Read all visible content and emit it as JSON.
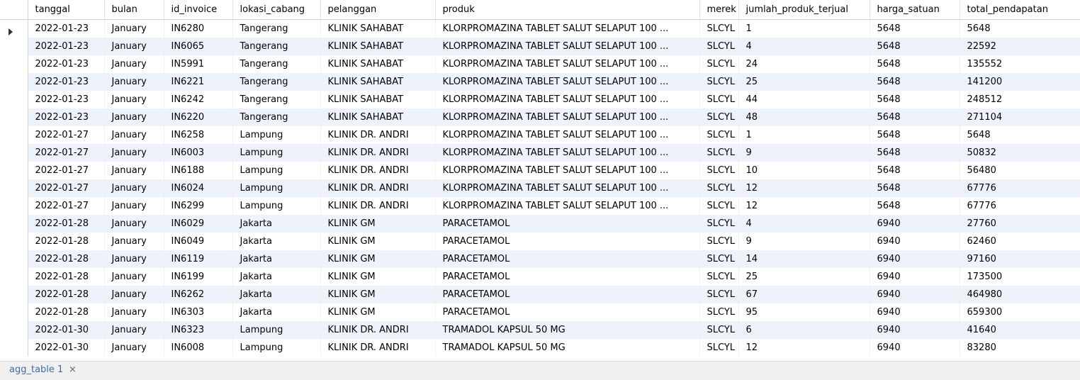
{
  "columns": [
    "tanggal",
    "bulan",
    "id_invoice",
    "lokasi_cabang",
    "pelanggan",
    "produk",
    "merek",
    "jumlah_produk_terjual",
    "harga_satuan",
    "total_pendapatan"
  ],
  "rows": [
    [
      "2022-01-23",
      "January",
      "IN6280",
      "Tangerang",
      "KLINIK SAHABAT",
      "KLORPROMAZINA TABLET SALUT SELAPUT 100 ...",
      "SLCYL",
      "1",
      "5648",
      "5648"
    ],
    [
      "2022-01-23",
      "January",
      "IN6065",
      "Tangerang",
      "KLINIK SAHABAT",
      "KLORPROMAZINA TABLET SALUT SELAPUT 100 ...",
      "SLCYL",
      "4",
      "5648",
      "22592"
    ],
    [
      "2022-01-23",
      "January",
      "IN5991",
      "Tangerang",
      "KLINIK SAHABAT",
      "KLORPROMAZINA TABLET SALUT SELAPUT 100 ...",
      "SLCYL",
      "24",
      "5648",
      "135552"
    ],
    [
      "2022-01-23",
      "January",
      "IN6221",
      "Tangerang",
      "KLINIK SAHABAT",
      "KLORPROMAZINA TABLET SALUT SELAPUT 100 ...",
      "SLCYL",
      "25",
      "5648",
      "141200"
    ],
    [
      "2022-01-23",
      "January",
      "IN6242",
      "Tangerang",
      "KLINIK SAHABAT",
      "KLORPROMAZINA TABLET SALUT SELAPUT 100 ...",
      "SLCYL",
      "44",
      "5648",
      "248512"
    ],
    [
      "2022-01-23",
      "January",
      "IN6220",
      "Tangerang",
      "KLINIK SAHABAT",
      "KLORPROMAZINA TABLET SALUT SELAPUT 100 ...",
      "SLCYL",
      "48",
      "5648",
      "271104"
    ],
    [
      "2022-01-27",
      "January",
      "IN6258",
      "Lampung",
      "KLINIK DR. ANDRI",
      "KLORPROMAZINA TABLET SALUT SELAPUT 100 ...",
      "SLCYL",
      "1",
      "5648",
      "5648"
    ],
    [
      "2022-01-27",
      "January",
      "IN6003",
      "Lampung",
      "KLINIK DR. ANDRI",
      "KLORPROMAZINA TABLET SALUT SELAPUT 100 ...",
      "SLCYL",
      "9",
      "5648",
      "50832"
    ],
    [
      "2022-01-27",
      "January",
      "IN6188",
      "Lampung",
      "KLINIK DR. ANDRI",
      "KLORPROMAZINA TABLET SALUT SELAPUT 100 ...",
      "SLCYL",
      "10",
      "5648",
      "56480"
    ],
    [
      "2022-01-27",
      "January",
      "IN6024",
      "Lampung",
      "KLINIK DR. ANDRI",
      "KLORPROMAZINA TABLET SALUT SELAPUT 100 ...",
      "SLCYL",
      "12",
      "5648",
      "67776"
    ],
    [
      "2022-01-27",
      "January",
      "IN6299",
      "Lampung",
      "KLINIK DR. ANDRI",
      "KLORPROMAZINA TABLET SALUT SELAPUT 100 ...",
      "SLCYL",
      "12",
      "5648",
      "67776"
    ],
    [
      "2022-01-28",
      "January",
      "IN6029",
      "Jakarta",
      "KLINIK GM",
      "PARACETAMOL",
      "SLCYL",
      "4",
      "6940",
      "27760"
    ],
    [
      "2022-01-28",
      "January",
      "IN6049",
      "Jakarta",
      "KLINIK GM",
      "PARACETAMOL",
      "SLCYL",
      "9",
      "6940",
      "62460"
    ],
    [
      "2022-01-28",
      "January",
      "IN6119",
      "Jakarta",
      "KLINIK GM",
      "PARACETAMOL",
      "SLCYL",
      "14",
      "6940",
      "97160"
    ],
    [
      "2022-01-28",
      "January",
      "IN6199",
      "Jakarta",
      "KLINIK GM",
      "PARACETAMOL",
      "SLCYL",
      "25",
      "6940",
      "173500"
    ],
    [
      "2022-01-28",
      "January",
      "IN6262",
      "Jakarta",
      "KLINIK GM",
      "PARACETAMOL",
      "SLCYL",
      "67",
      "6940",
      "464980"
    ],
    [
      "2022-01-28",
      "January",
      "IN6303",
      "Jakarta",
      "KLINIK GM",
      "PARACETAMOL",
      "SLCYL",
      "95",
      "6940",
      "659300"
    ],
    [
      "2022-01-30",
      "January",
      "IN6323",
      "Lampung",
      "KLINIK DR. ANDRI",
      "TRAMADOL KAPSUL 50 MG",
      "SLCYL",
      "6",
      "6940",
      "41640"
    ],
    [
      "2022-01-30",
      "January",
      "IN6008",
      "Lampung",
      "KLINIK DR. ANDRI",
      "TRAMADOL KAPSUL 50 MG",
      "SLCYL",
      "12",
      "6940",
      "83280"
    ]
  ],
  "current_row_icon": "row-pointer-icon",
  "tab": {
    "label": "agg_table 1",
    "close": "×",
    "close_icon": "close-icon"
  },
  "colors": {
    "alt_row": "#eef3fb",
    "tab_text": "#3b6ea5"
  }
}
